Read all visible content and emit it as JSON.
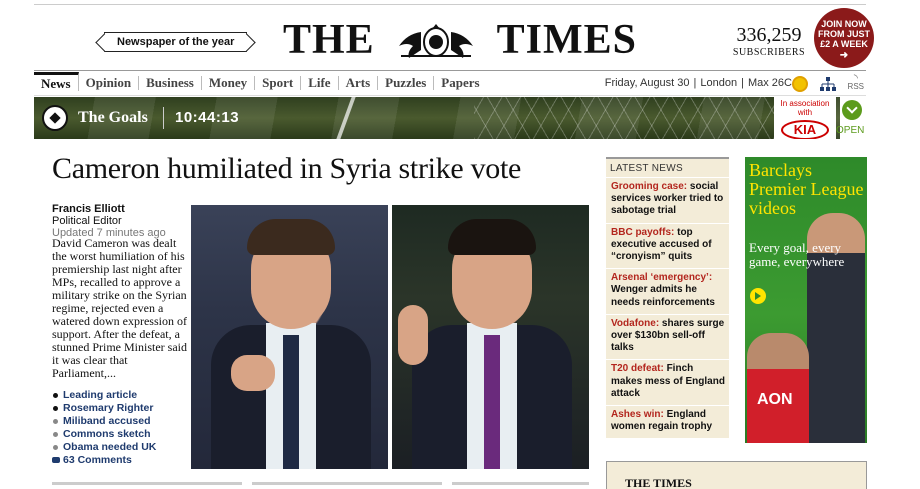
{
  "masthead": {
    "newspaper_of_year": "Newspaper of the year",
    "logo_left": "THE",
    "logo_right": "TIMES",
    "subscribers_count": "336,259",
    "subscribers_label": "SUBSCRIBERS",
    "join_line1": "JOIN NOW",
    "join_line2": "FROM JUST",
    "join_line3": "£2 A WEEK"
  },
  "nav": {
    "tabs": [
      "News",
      "Opinion",
      "Business",
      "Money",
      "Sport",
      "Life",
      "Arts",
      "Puzzles",
      "Papers"
    ],
    "date": "Friday, August 30",
    "location": "London",
    "temp": "Max 26C",
    "rss": "RSS"
  },
  "goals_banner": {
    "title": "The Goals",
    "time": "10:44:13",
    "assoc": "In association with",
    "sponsor": "KIA",
    "open": "OPEN"
  },
  "lead": {
    "headline": "Cameron humiliated in Syria strike vote",
    "author": "Francis Elliott",
    "role": "Political Editor",
    "updated": "Updated 7 minutes ago",
    "summary": "David Cameron was dealt the worst humiliation of his premiership last night after MPs, recalled to approve a military strike on the Syrian regime, rejected even a watered down expression of support. After the defeat, a stunned Prime Minister said it was clear that Parliament,...",
    "related": [
      "Leading article",
      "Rosemary Righter",
      "Miliband accused",
      "Commons sketch",
      "Obama needed UK"
    ],
    "comments": "63 Comments"
  },
  "latest": {
    "header": "LATEST NEWS",
    "items": [
      {
        "kw": "Grooming case:",
        "text": " social services worker tried to sabotage trial"
      },
      {
        "kw": "BBC payoffs:",
        "text": " top executive accused of “cronyism” quits"
      },
      {
        "kw": "Arsenal ‘emergency’:",
        "text": " Wenger admits he needs reinforcements"
      },
      {
        "kw": "Vodafone:",
        "text": " shares surge over $130bn sell-off talks"
      },
      {
        "kw": "T20 defeat:",
        "text": " Finch makes mess of England attack"
      },
      {
        "kw": "Ashes win:",
        "text": " England women regain trophy"
      }
    ]
  },
  "ad": {
    "title": "Barclays Premier League videos",
    "tagline": "Every goal, every game, everywhere",
    "shirt_text": "AON"
  },
  "teaser": {
    "title": "THE TIMES"
  },
  "colors": {
    "accent_red": "#b3261e",
    "join_bg": "#8b1a1a",
    "link_blue": "#1f3b6e",
    "latest_bg": "#f3ecd8",
    "ad_green": "#2e8a2a"
  }
}
